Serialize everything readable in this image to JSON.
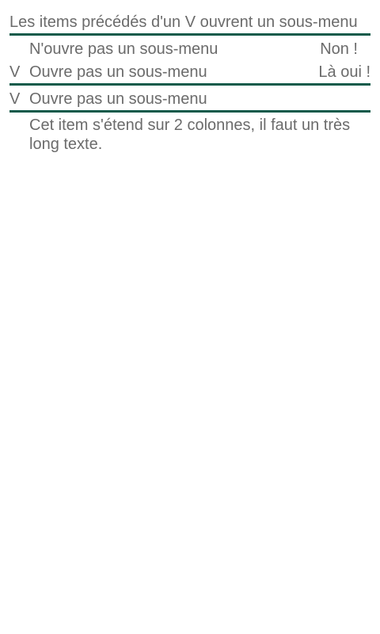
{
  "intro": {
    "text": "Les items précédés d'un V ouvrent un sous-menu"
  },
  "menu": {
    "items": [
      {
        "marker": "",
        "label": "N'ouvre pas un sous-menu",
        "right": "Non !"
      },
      {
        "marker": "V",
        "label": "Ouvre pas un sous-menu",
        "right": "Là oui !"
      },
      {
        "marker": "V",
        "label": "Ouvre pas un sous-menu",
        "right": ""
      },
      {
        "marker": "",
        "label": "Cet item s'étend sur 2 colonnes, il faut un très long texte."
      }
    ]
  },
  "colors": {
    "divider": "#0f5a4a",
    "text": "#6b6b6b",
    "background": "#ffffff"
  }
}
